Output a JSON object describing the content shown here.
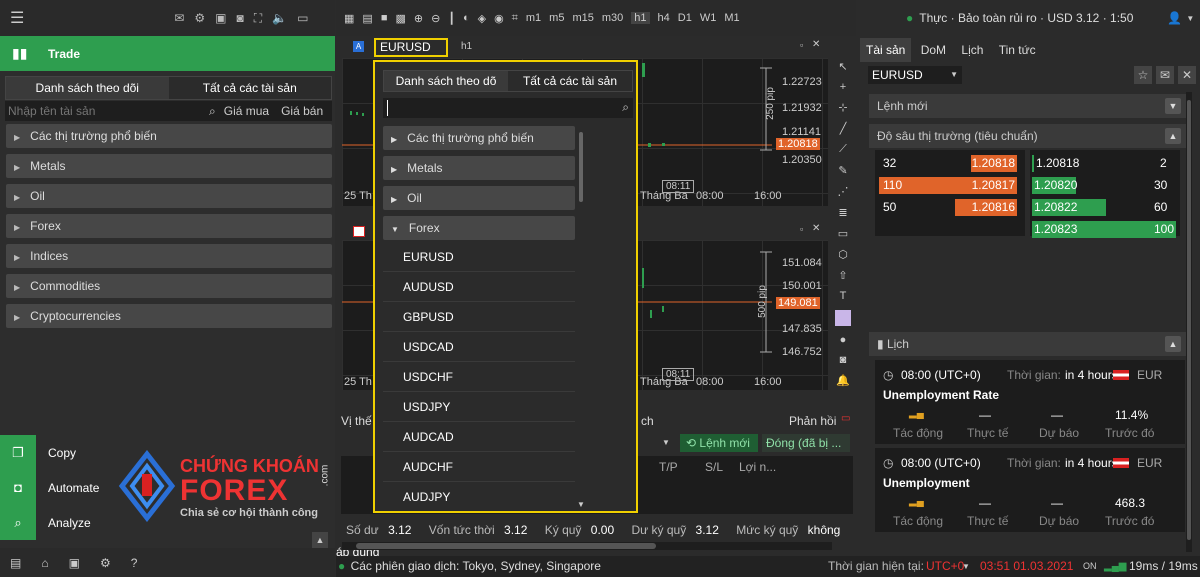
{
  "left": {
    "trade_label": "Trade",
    "tabs": [
      "Danh sách theo dõi",
      "Tất cả các tài sản"
    ],
    "search_placeholder": "Nhập tên tài sản",
    "col_bid": "Giá mua",
    "col_ask": "Giá bán",
    "categories": [
      "Các thị trường phổ biến",
      "Metals",
      "Oil",
      "Forex",
      "Indices",
      "Commodities",
      "Cryptocurrencies"
    ],
    "bottom_items": [
      "Copy",
      "Automate",
      "Analyze"
    ]
  },
  "watermark": {
    "line1": "CHỨNG KHOÁN",
    "line2": "FOREX",
    ".com": ".com",
    "tagline": "Chia sẻ cơ hội thành công"
  },
  "toolbar": {
    "timeframes": [
      "m1",
      "m5",
      "m15",
      "m30",
      "h1",
      "h4",
      "D1",
      "W1",
      "M1"
    ]
  },
  "status": {
    "text": "Thực · Bảo toàn rủi ro · USD 3.12 · 1:50"
  },
  "chart1": {
    "symbol": "EURUSD",
    "timeframe": "h1",
    "prices": [
      "1.22723",
      "1.21932",
      "1.21141",
      "1.20818",
      "1.20350"
    ],
    "pip_label": "250 pip",
    "x_labels": [
      "25 Th",
      "Tháng Ba",
      "08:00",
      "16:00"
    ],
    "cursor_time": "08:11"
  },
  "chart2": {
    "prices": [
      "151.084",
      "150.001",
      "149.081",
      "147.835",
      "146.752"
    ],
    "pip_label": "500 pip",
    "x_labels": [
      "25 Th",
      "Tháng Ba",
      "08:00",
      "16:00"
    ],
    "cursor_time": "08:11"
  },
  "popup": {
    "tabs": [
      "Danh sách theo dõ",
      "Tất cả các tài sản"
    ],
    "categories": [
      "Các thị trường phổ biến",
      "Metals",
      "Oil",
      "Forex"
    ],
    "symbols": [
      "EURUSD",
      "AUDUSD",
      "GBPUSD",
      "USDCAD",
      "USDCHF",
      "USDJPY",
      "AUDCAD",
      "AUDCHF",
      "AUDJPY"
    ]
  },
  "positions": {
    "tab1": "Vị thế",
    "tab2": "ch",
    "feedback": "Phản hồi",
    "new_order": "Lệnh mới",
    "close": "Đóng (đã bị ...",
    "cols": [
      "T/P",
      "S/L",
      "Lợi n..."
    ]
  },
  "balances": {
    "items": [
      {
        "label": "Số dư",
        "value": "3.12"
      },
      {
        "label": "Vốn tức thời",
        "value": "3.12"
      },
      {
        "label": "Ký quỹ",
        "value": "0.00"
      },
      {
        "label": "Dư ký quỹ",
        "value": "3.12"
      },
      {
        "label": "Mức ký quỹ",
        "value": "không áp dụng"
      }
    ]
  },
  "right": {
    "tabs": [
      "Tài sản",
      "DoM",
      "Lịch",
      "Tin tức"
    ],
    "symbol": "EURUSD",
    "new_order": "Lệnh mới",
    "depth_title": "Độ sâu thị trường (tiêu chuẩn)",
    "bids": [
      {
        "vol": "32",
        "price": "1.20818"
      },
      {
        "vol": "110",
        "price": "1.20817"
      },
      {
        "vol": "50",
        "price": "1.20816"
      }
    ],
    "asks": [
      {
        "price": "1.20818",
        "vol": "2"
      },
      {
        "price": "1.20820",
        "vol": "30"
      },
      {
        "price": "1.20822",
        "vol": "60"
      },
      {
        "price": "1.20823",
        "vol": "100"
      }
    ],
    "calendar_title": "Lịch",
    "events": [
      {
        "time": "08:00 (UTC+0)",
        "when_label": "Thời gian:",
        "when": "in 4 hours",
        "ccy": "EUR",
        "name": "Unemployment Rate",
        "cols": [
          "Tác động",
          "Thực tế",
          "Dự báo",
          "Trước đó"
        ],
        "vals": [
          "",
          "—",
          "—",
          "11.4%"
        ]
      },
      {
        "time": "08:00 (UTC+0)",
        "when_label": "Thời gian:",
        "when": "in 4 hours",
        "ccy": "EUR",
        "name": "Unemployment",
        "cols": [
          "Tác động",
          "Thực tế",
          "Dự báo",
          "Trước đó"
        ],
        "vals": [
          "",
          "—",
          "—",
          "468.3"
        ]
      }
    ]
  },
  "statusbar": {
    "sessions": "Các phiên giao dịch: Tokyo, Sydney, Singapore",
    "server_label": "Thời gian hiện tại:",
    "tz": "UTC+0",
    "datetime": "03:51 01.03.2021",
    "latency": "19ms / 19ms"
  }
}
